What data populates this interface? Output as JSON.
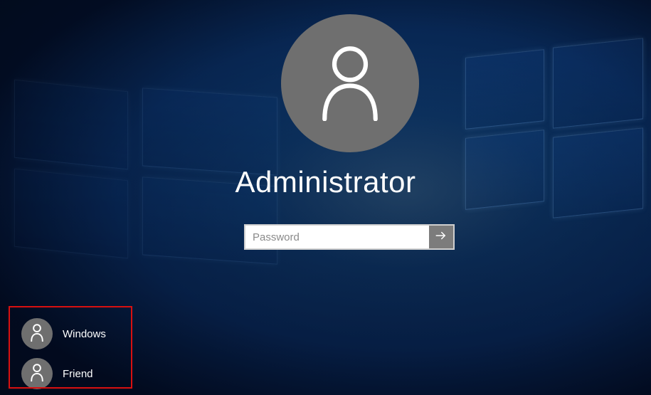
{
  "login": {
    "current_user": "Administrator",
    "password_placeholder": "Password"
  },
  "user_list": [
    {
      "label": "Windows"
    },
    {
      "label": "Friend"
    }
  ],
  "icons": {
    "avatar": "person-icon",
    "submit": "arrow-right-icon"
  },
  "colors": {
    "avatar_bg": "#6f6f6f",
    "submit_bg": "#7c7c7c",
    "highlight_border": "#d81010"
  }
}
